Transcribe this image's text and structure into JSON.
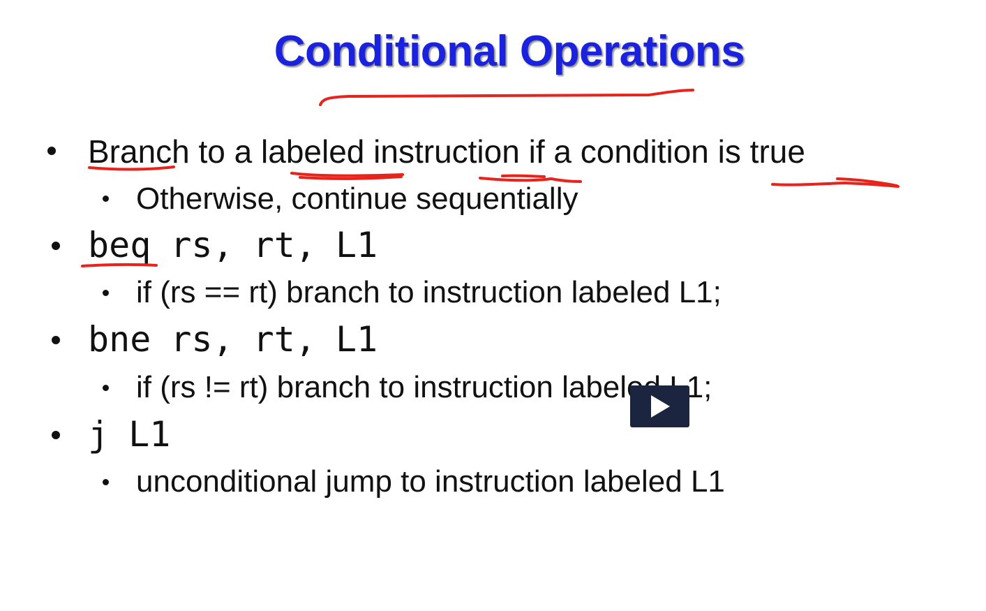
{
  "slide": {
    "title": "Conditional Operations",
    "bullets": [
      {
        "text": "Branch to a labeled instruction if a condition is true",
        "sub": "Otherwise, continue sequentially"
      },
      {
        "code": [
          "beq",
          "rs,",
          "rt,",
          "L1"
        ],
        "sub": "if (rs == rt) branch to instruction labeled L1;"
      },
      {
        "code": [
          "bne",
          "rs,",
          "rt,",
          "L1"
        ],
        "sub": "if (rs != rt) branch to instruction labeled L1;"
      },
      {
        "code": [
          "j",
          "L1"
        ],
        "sub": "unconditional jump to instruction labeled L1"
      }
    ]
  },
  "colors": {
    "title": "#1a22dd",
    "annotation": "#e8231c",
    "play_button": "#1b2540"
  },
  "icons": {
    "play": "play-icon"
  }
}
